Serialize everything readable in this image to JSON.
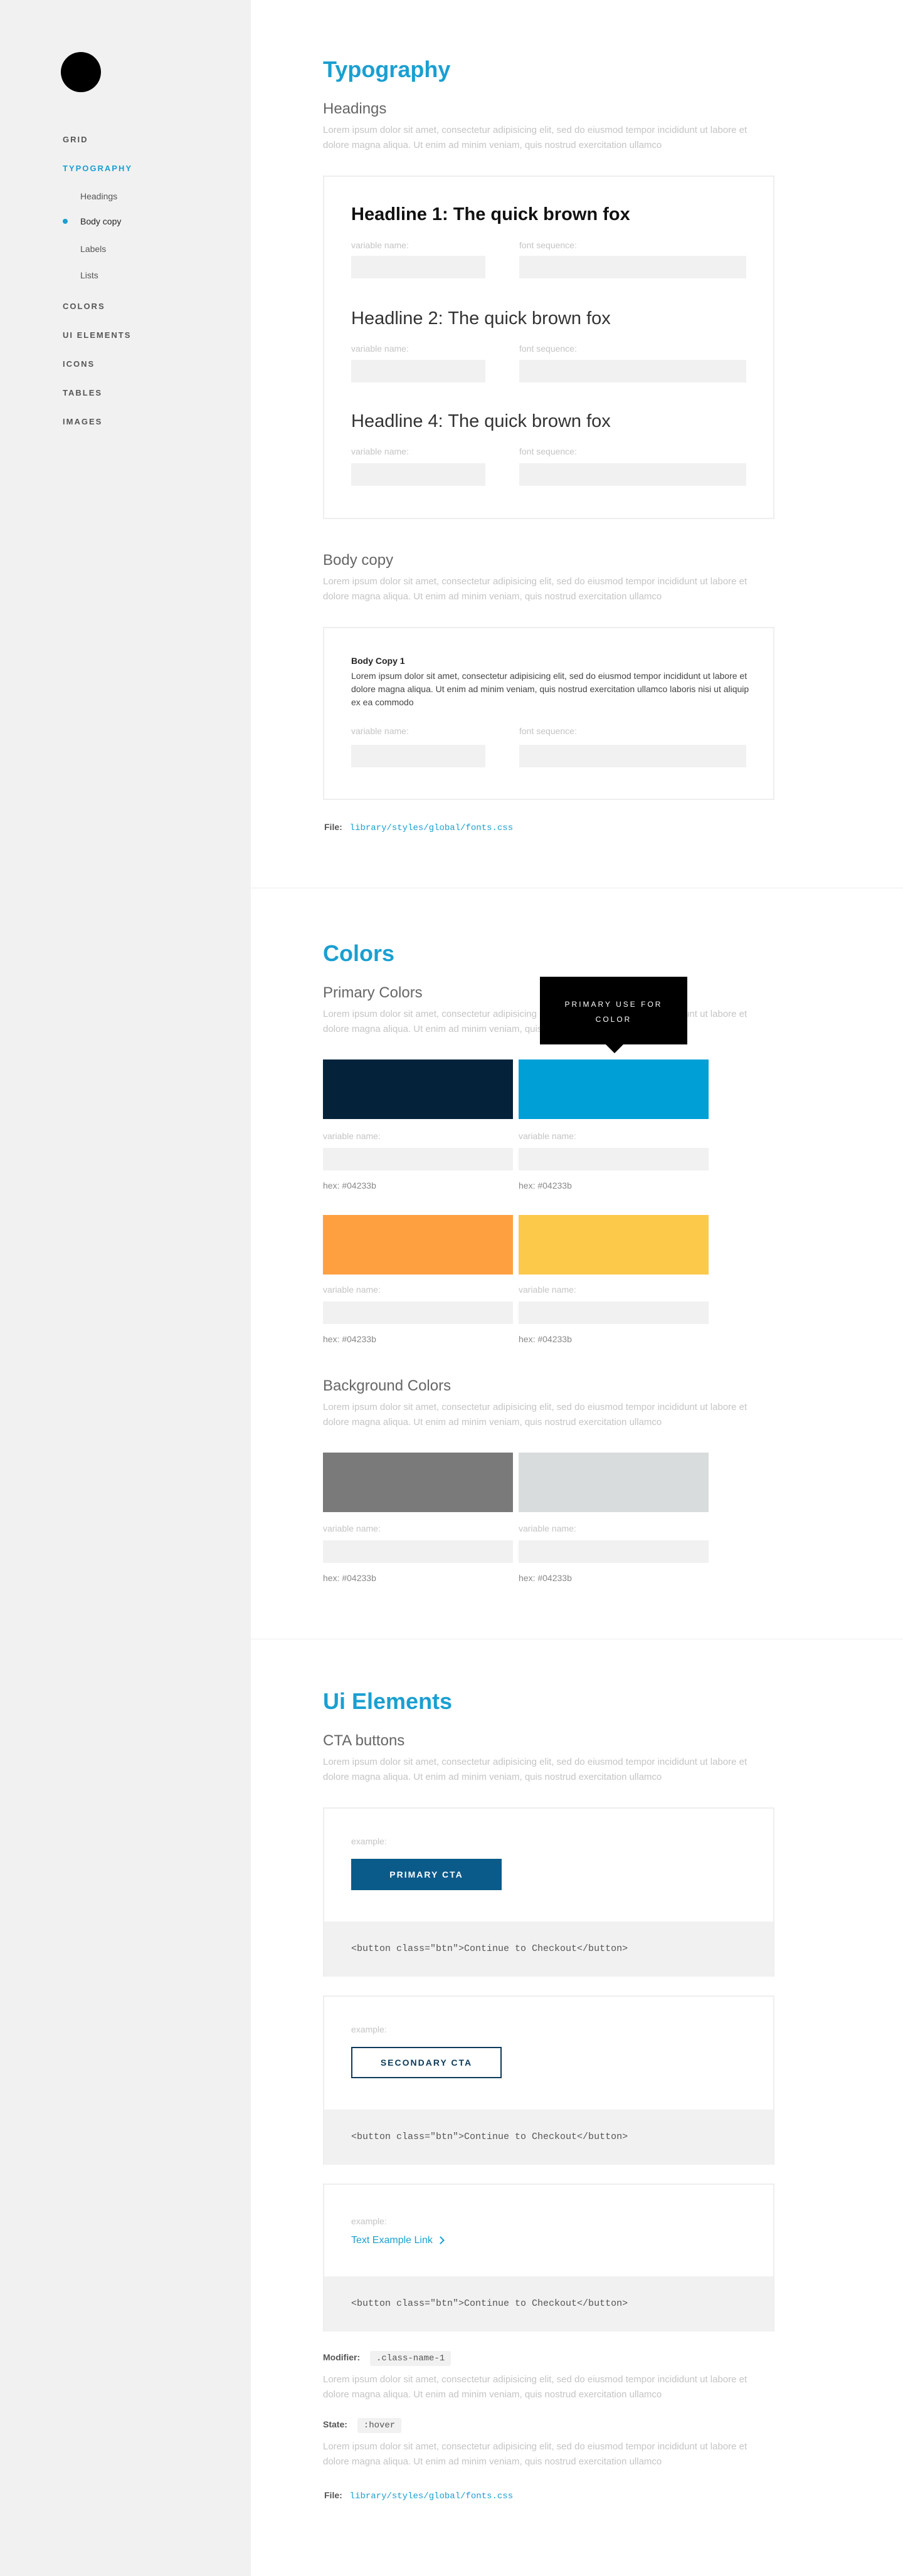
{
  "sidebar": {
    "nav": [
      {
        "label": "GRID"
      },
      {
        "label": "TYPOGRAPHY"
      },
      {
        "label": "COLORS"
      },
      {
        "label": "UI ELEMENTS"
      },
      {
        "label": "ICONS"
      },
      {
        "label": "TABLES"
      },
      {
        "label": "IMAGES"
      }
    ],
    "typography_sub": [
      {
        "label": "Headings"
      },
      {
        "label": "Body copy"
      },
      {
        "label": "Labels"
      },
      {
        "label": "Lists"
      }
    ]
  },
  "lorem": "Lorem ipsum dolor sit amet, consectetur adipisicing elit, sed do eiusmod tempor incididunt ut labore et dolore magna aliqua. Ut enim ad minim veniam, quis nostrud exercitation ullamco",
  "field_labels": {
    "variable": "variable name:",
    "font": "font sequence:"
  },
  "typography": {
    "title": "Typography",
    "headings_title": "Headings",
    "h1": "Headline 1: The quick brown fox",
    "h2": "Headline 2: The quick brown fox",
    "h4": "Headline 4: The quick brown fox",
    "body_title": "Body copy",
    "body_copy_label": "Body Copy 1",
    "body_copy_text": "Lorem ipsum dolor sit amet, consectetur adipisicing elit, sed do eiusmod tempor incididunt ut labore et dolore magna aliqua. Ut enim ad minim veniam, quis nostrud exercitation ullamco laboris nisi ut aliquip ex ea commodo",
    "file_label": "File:",
    "file_path": "library/styles/global/fonts.css"
  },
  "colors": {
    "title": "Colors",
    "primary_title": "Primary Colors",
    "tooltip": "PRIMARY USE FOR COLOR",
    "swatches": [
      {
        "color": "#04233b",
        "hex": "hex: #04233b",
        "label": "variable name:"
      },
      {
        "color": "#009fd6",
        "hex": "hex: #04233b",
        "label": "variable name:"
      },
      {
        "color": "#ffa040",
        "hex": "hex: #04233b",
        "label": "variable name:"
      },
      {
        "color": "#fdc94a",
        "hex": "hex: #04233b",
        "label": "variable name:"
      }
    ],
    "background_title": "Background Colors",
    "background_swatches": [
      {
        "color": "#7a7a7a",
        "hex": "hex: #04233b",
        "label": "variable name:"
      },
      {
        "color": "#d9dcdc",
        "hex": "hex: #04233b",
        "label": "variable name:"
      }
    ]
  },
  "ui_elements": {
    "title": "Ui Elements",
    "cta_title": "CTA buttons",
    "example_label": "example:",
    "primary_cta": "PRIMARY CTA",
    "secondary_cta": "SECONDARY CTA",
    "text_link": "Text Example Link",
    "code": "<button class=\"btn\">Continue to Checkout</button>",
    "modifier_label": "Modifier:",
    "modifier_value": ".class-name-1",
    "state_label": "State:",
    "state_value": ":hover",
    "file_label": "File:",
    "file_path": "library/styles/global/fonts.css"
  }
}
